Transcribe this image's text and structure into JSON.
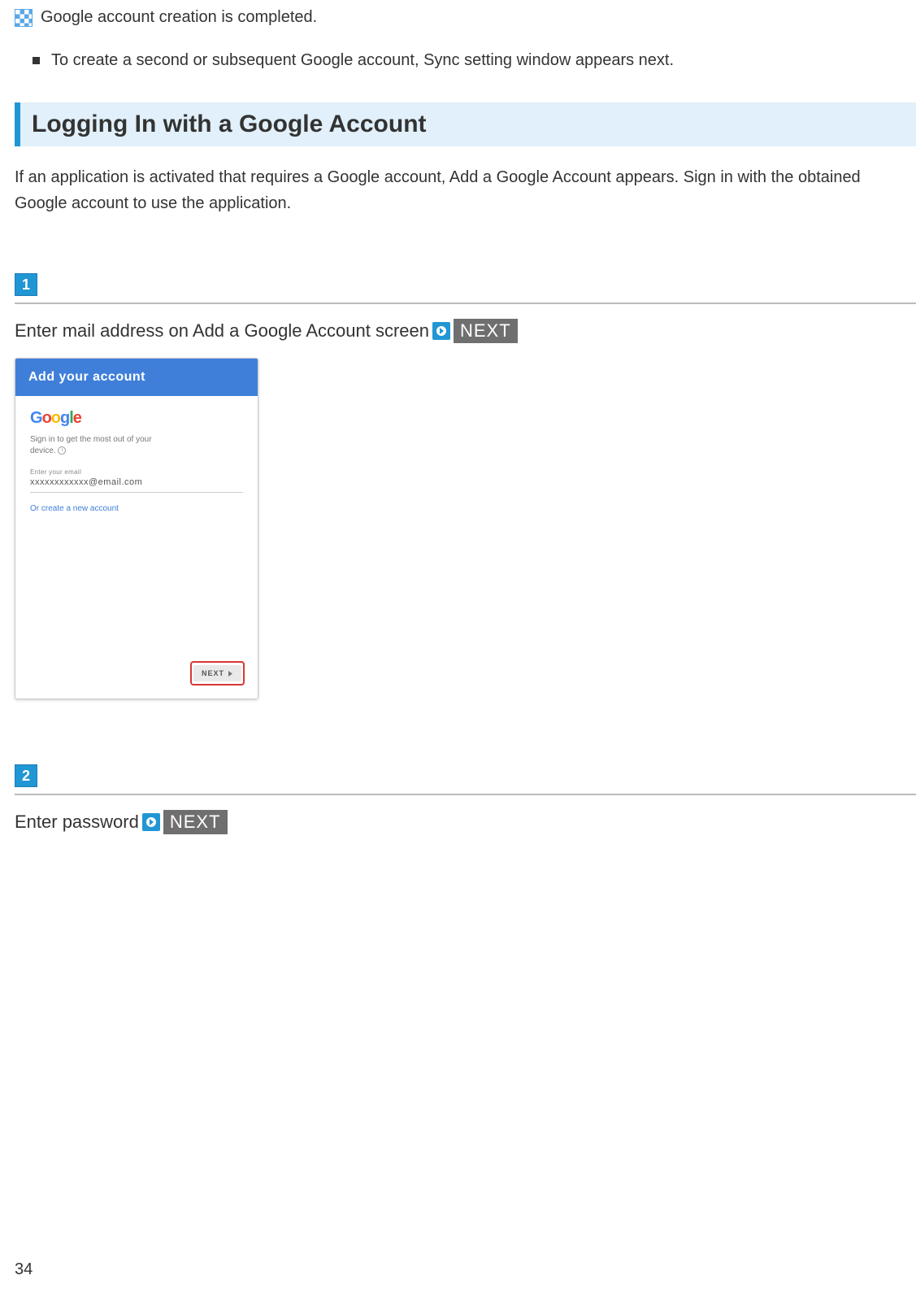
{
  "result_text": "Google account creation is completed.",
  "bullet_text": "To create a second or subsequent Google account, Sync setting window appears next.",
  "section_heading": "Logging In with a Google Account",
  "section_body": "If an application is activated that requires a Google account, Add a Google Account appears. Sign in with the obtained Google account to use the application.",
  "steps": {
    "s1": {
      "num": "1",
      "instruction": "Enter mail address on Add a Google Account screen",
      "next_label": "NEXT"
    },
    "s2": {
      "num": "2",
      "instruction": "Enter password",
      "next_label": "NEXT"
    }
  },
  "mockup": {
    "header": "Add your account",
    "logo": {
      "g": "G",
      "o1": "o",
      "o2": "o",
      "g2": "g",
      "l": "l",
      "e": "e"
    },
    "desc_line1": "Sign in to get the most out of your",
    "desc_line2": "device.",
    "input_label": "Enter your email",
    "input_value": "xxxxxxxxxxxx@email.com",
    "create_link": "Or create a new account",
    "next_btn": "NEXT"
  },
  "page_number": "34"
}
